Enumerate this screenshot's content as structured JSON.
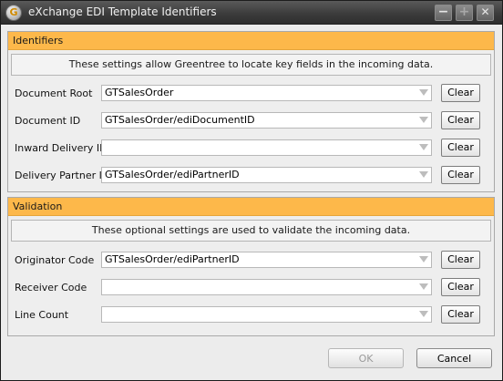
{
  "window": {
    "title": "eXchange EDI Template Identifiers",
    "icon_glyph": "G",
    "controls": {
      "minimize": "−",
      "maximize": "+",
      "close": "✕"
    }
  },
  "identifiers": {
    "header": "Identifiers",
    "info": "These settings allow Greentree to locate key fields in the incoming data.",
    "rows": [
      {
        "label": "Document Root",
        "value": "GTSalesOrder",
        "clear": "Clear"
      },
      {
        "label": "Document ID",
        "value": "GTSalesOrder/ediDocumentID",
        "clear": "Clear"
      },
      {
        "label": "Inward Delivery ID",
        "value": "",
        "clear": "Clear"
      },
      {
        "label": "Delivery Partner ID",
        "value": "GTSalesOrder/ediPartnerID",
        "clear": "Clear"
      }
    ]
  },
  "validation": {
    "header": "Validation",
    "info": "These optional settings are used to validate the incoming data.",
    "rows": [
      {
        "label": "Originator Code",
        "value": "GTSalesOrder/ediPartnerID",
        "clear": "Clear"
      },
      {
        "label": "Receiver Code",
        "value": "",
        "clear": "Clear"
      },
      {
        "label": "Line Count",
        "value": "",
        "clear": "Clear"
      }
    ]
  },
  "footer": {
    "ok": "OK",
    "cancel": "Cancel"
  },
  "colors": {
    "section_header": "#fdb84a",
    "titlebar": "#3c3c3c"
  }
}
